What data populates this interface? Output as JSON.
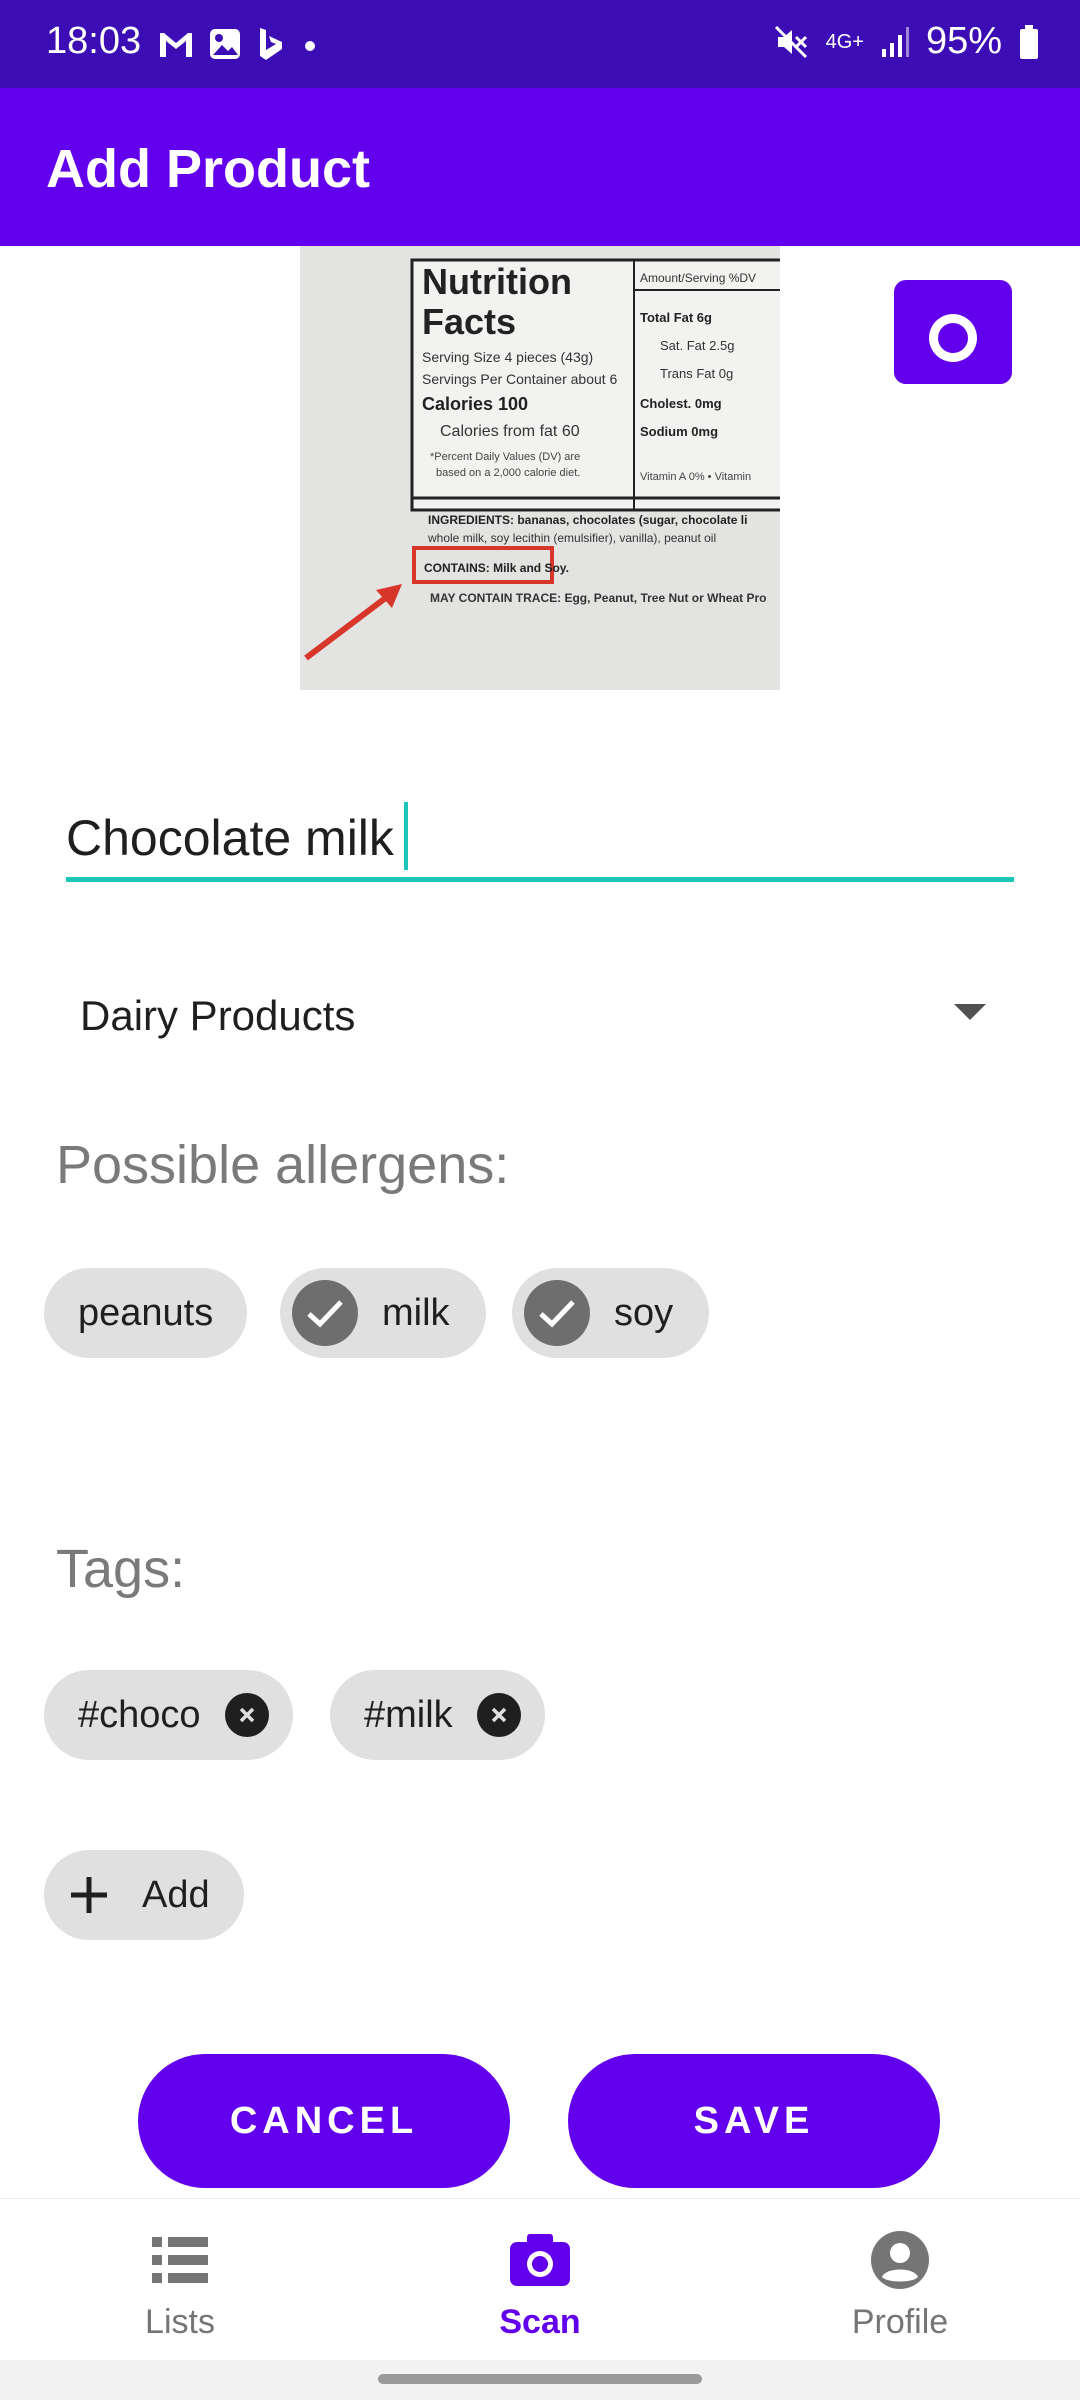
{
  "status_bar": {
    "time": "18:03",
    "network": "4G+",
    "battery": "95%"
  },
  "app_bar": {
    "title": "Add Product"
  },
  "photo": {
    "label_title_line1": "Nutrition",
    "label_title_line2": "Facts",
    "serving_size": "Serving Size 4 pieces (43g)",
    "servings_per_container": "Servings Per Container about 6",
    "calories": "Calories 100",
    "calories_from_fat": "Calories from fat 60",
    "daily_values_note_1": "*Percent Daily Values (DV) are",
    "daily_values_note_2": "based on a 2,000 calorie diet.",
    "amount_per_serving": "Amount/Serving  %DV",
    "total_fat": "Total Fat 6g",
    "sat_fat": "Sat. Fat 2.5g",
    "trans_fat": "Trans Fat 0g",
    "cholest": "Cholest. 0mg",
    "sodium": "Sodium 0mg",
    "vitamin": "Vitamin A 0% • Vitamin",
    "ingredients_1": "INGREDIENTS: bananas, chocolates (sugar, chocolate li",
    "ingredients_2": "whole milk, soy lecithin (emulsifier), vanilla), peanut oil",
    "contains": "CONTAINS: Milk and Soy.",
    "may_contain": "MAY CONTAIN TRACE: Egg, Peanut, Tree Nut or Wheat Pro"
  },
  "product": {
    "name": "Chocolate milk",
    "category": "Dairy Products"
  },
  "allergens": {
    "heading": "Possible allergens:",
    "items": [
      {
        "label": "peanuts",
        "selected": false
      },
      {
        "label": "milk",
        "selected": true
      },
      {
        "label": "soy",
        "selected": true
      }
    ]
  },
  "tags": {
    "heading": "Tags:",
    "items": [
      "#choco",
      "#milk"
    ],
    "add_label": "Add"
  },
  "actions": {
    "cancel_label": "CANCEL",
    "save_label": "SAVE"
  },
  "bottom_nav": {
    "items": [
      {
        "label": "Lists",
        "icon": "list-icon",
        "active": false
      },
      {
        "label": "Scan",
        "icon": "camera-icon",
        "active": true
      },
      {
        "label": "Profile",
        "icon": "account-icon",
        "active": false
      }
    ]
  },
  "colors": {
    "primary": "#6200ee",
    "status_bar": "#3c0db4",
    "accent": "#1ec8b9",
    "chip": "#e0e0e0"
  }
}
